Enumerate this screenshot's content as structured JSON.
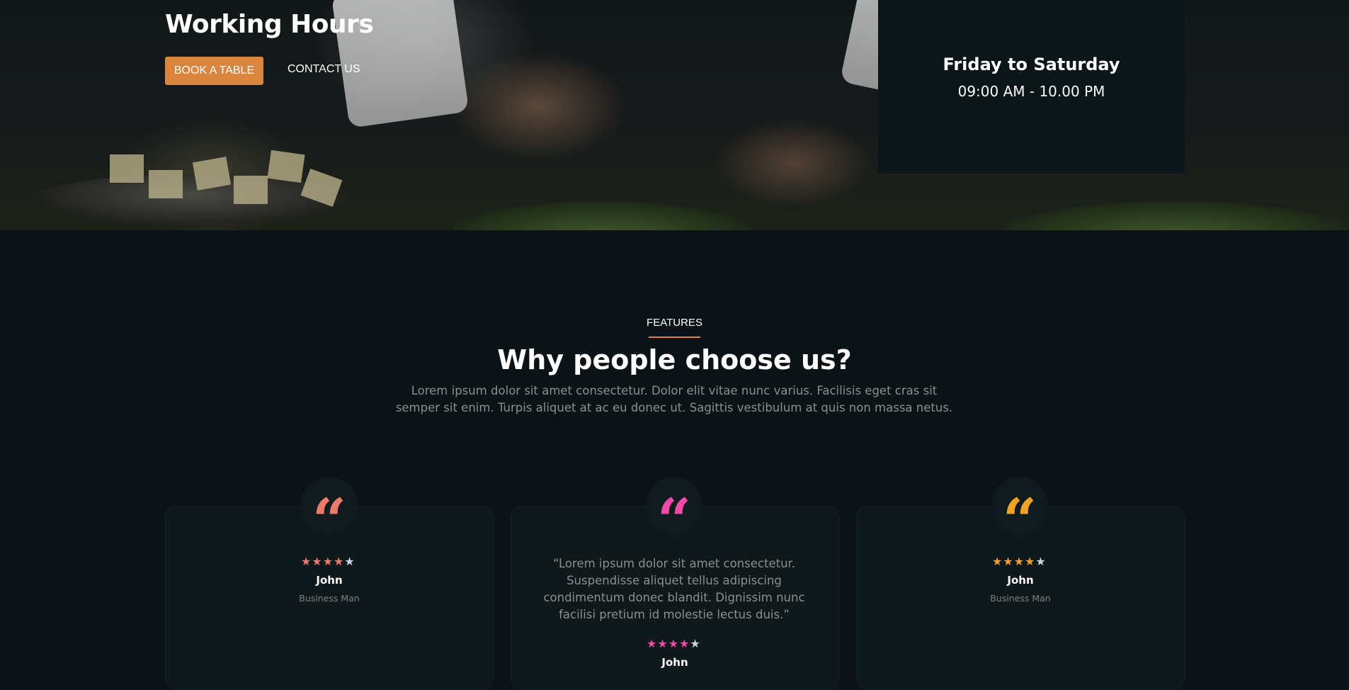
{
  "hero": {
    "title": "Working Hours",
    "book_button": "BOOK A TABLE",
    "contact_link": "CONTACT US",
    "hours_days": "Friday to Saturday",
    "hours_time": "09:00 AM - 10.00 PM"
  },
  "features": {
    "tag": "FEATURES",
    "title": "Why people choose us?",
    "description": "Lorem ipsum dolor sit amet consectetur. Dolor elit vitae nunc varius. Facilisis eget cras sit semper sit enim. Turpis aliquet at ac eu donec ut. Sagittis vestibulum at quis non massa netus."
  },
  "testimonials": [
    {
      "quote_mark": "“",
      "accent": "#ec7a6a",
      "rating": 4,
      "max_rating": 5,
      "name": "John",
      "role": "Business Man"
    },
    {
      "quote_mark": "“",
      "accent": "#ee4aa8",
      "quote": "“Lorem ipsum dolor sit amet consectetur. Suspendisse aliquet tellus adipiscing condimentum donec blandit. Dignissim nunc facilisi pretium id molestie lectus duis.”",
      "rating": 4,
      "max_rating": 5,
      "name": "John"
    },
    {
      "quote_mark": "“",
      "accent": "#f0a224",
      "rating": 4,
      "max_rating": 5,
      "name": "John",
      "role": "Business Man"
    }
  ],
  "colors": {
    "background": "#0c1316",
    "accent": "#d9843f",
    "inactive_star": "#c9d6e3"
  }
}
